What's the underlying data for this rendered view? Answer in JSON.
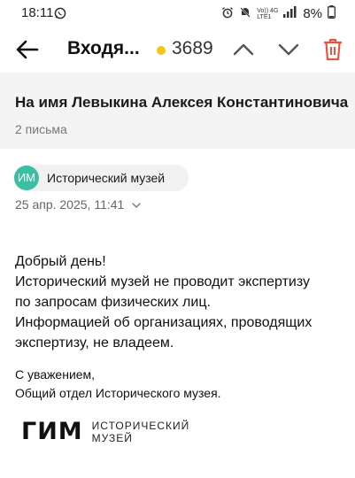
{
  "status_bar": {
    "time": "18:11",
    "battery": "8%",
    "icons": [
      "whatsapp-icon",
      "alarm-icon",
      "mute-icon",
      "volte-icon",
      "4g-icon",
      "signal-icon",
      "battery-icon"
    ],
    "net_top": "Vo)) 4G",
    "net_bottom": "LTE1"
  },
  "app_bar": {
    "title": "Входя...",
    "unread_count": "3689",
    "dot_color": "#f5c518",
    "trash_color": "#e8553e"
  },
  "thread": {
    "subject": "На имя Левыкина Алексея Константиновича",
    "letters_count": "2 письма"
  },
  "message": {
    "sender_initials": "ИМ",
    "sender_name": "Исторический музей",
    "avatar_color": "#3bbfa3",
    "date": "25 апр. 2025, 11:41",
    "body_lines": [
      "Добрый день!",
      "Исторический музей не проводит экспертизу",
      "по запросам физических лиц.",
      "Информацией об организациях, проводящих",
      "экспертизу, не владеем."
    ],
    "signature_lines": [
      "С уважением,",
      "Общий отдел Исторического музея."
    ],
    "logo_mark": "ГИМ",
    "logo_text_line1": "ИСТОРИЧЕСКИЙ",
    "logo_text_line2": "МУЗЕЙ"
  }
}
